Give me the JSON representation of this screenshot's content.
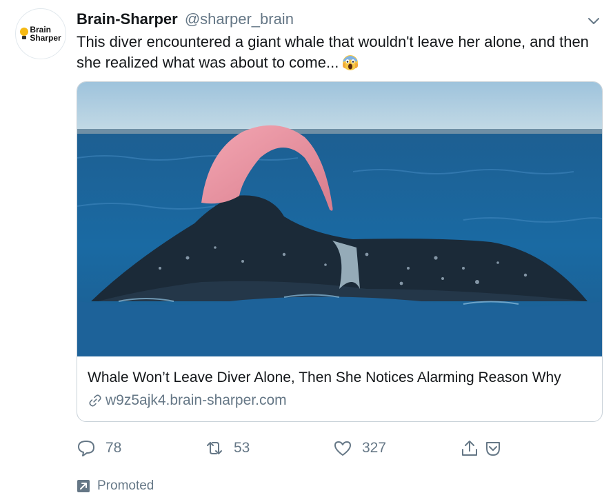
{
  "tweet": {
    "author_name": "Brain-Sharper",
    "author_handle": "@sharper_brain",
    "avatar_logo": [
      "Brain",
      "Sharper"
    ],
    "text": "This diver encountered a giant whale that wouldn't leave her alone, and then she realized what was about to come...",
    "emoji": "screaming-face-emoji"
  },
  "card": {
    "title": "Whale Won’t Leave Diver Alone, Then She Notices Alarming Reason Why",
    "domain": "w9z5ajk4.brain-sharper.com"
  },
  "actions": {
    "reply_count": "78",
    "retweet_count": "53",
    "like_count": "327"
  },
  "promoted_label": "Promoted",
  "icons": [
    "chevron-down-icon",
    "link-icon",
    "reply-icon",
    "retweet-icon",
    "like-icon",
    "share-icon",
    "promoted-icon"
  ],
  "colors": {
    "secondary_text": "#657786",
    "primary_text": "#14171a",
    "card_border": "#c8d1d8"
  }
}
